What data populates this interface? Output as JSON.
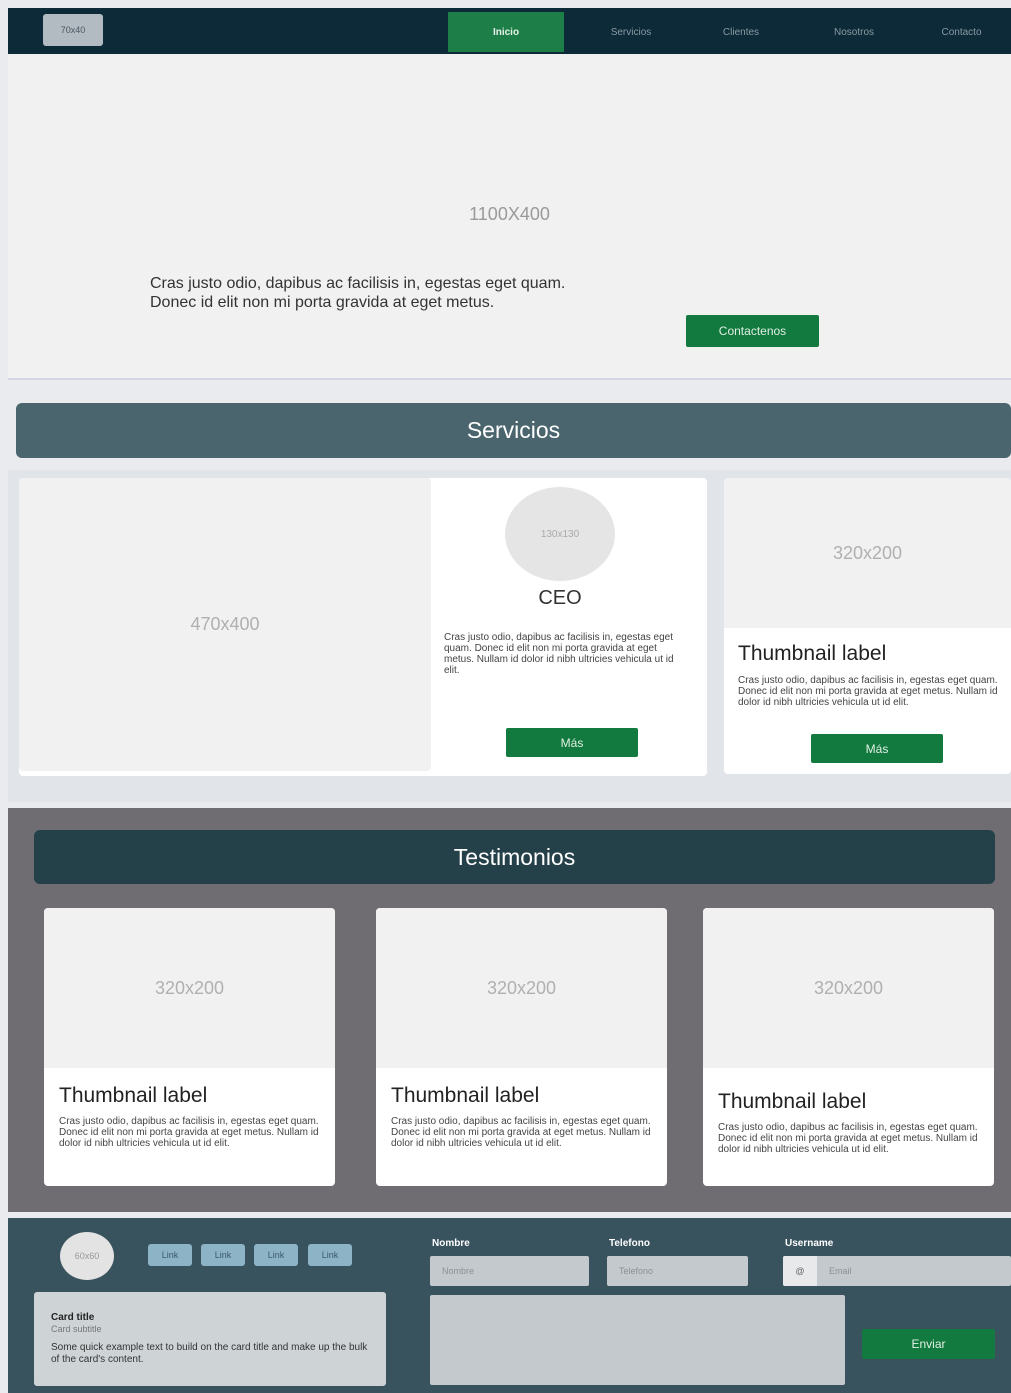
{
  "navbar": {
    "logo": "70x40",
    "items": [
      {
        "label": "Inicio",
        "active": true
      },
      {
        "label": "Servicios",
        "active": false
      },
      {
        "label": "Clientes",
        "active": false
      },
      {
        "label": "Nosotros",
        "active": false
      },
      {
        "label": "Contacto",
        "active": false
      }
    ]
  },
  "hero": {
    "placeholder": "1100X400",
    "text": "Cras justo odio, dapibus ac facilisis in, egestas eget quam. Donec id elit non mi porta gravida at eget metus.",
    "button": "Contactenos"
  },
  "servicios": {
    "title": "Servicios",
    "main_placeholder": "470x400",
    "ceo": {
      "avatar": "130x130",
      "title": "CEO",
      "text": "Cras justo odio, dapibus ac facilisis in, egestas eget quam. Donec id elit non mi porta gravida at eget metus. Nullam id dolor id nibh ultricies vehicula ut id elit.",
      "button": "Más"
    },
    "thumb": {
      "placeholder": "320x200",
      "label": "Thumbnail label",
      "text": "Cras justo odio, dapibus ac facilisis in, egestas eget quam. Donec id elit non mi porta gravida at eget metus. Nullam id dolor id nibh ultricies vehicula ut id elit.",
      "button": "Más"
    }
  },
  "testimonios": {
    "title": "Testimonios",
    "cards": [
      {
        "placeholder": "320x200",
        "label": "Thumbnail label",
        "text": "Cras justo odio, dapibus ac facilisis in, egestas eget quam. Donec id elit non mi porta gravida at eget metus. Nullam id dolor id nibh ultricies vehicula ut id elit."
      },
      {
        "placeholder": "320x200",
        "label": "Thumbnail label",
        "text": "Cras justo odio, dapibus ac facilisis in, egestas eget quam. Donec id elit non mi porta gravida at eget metus. Nullam id dolor id nibh ultricies vehicula ut id elit."
      },
      {
        "placeholder": "320x200",
        "label": "Thumbnail label",
        "text": "Cras justo odio, dapibus ac facilisis in, egestas eget quam. Donec id elit non mi porta gravida at eget metus. Nullam id dolor id nibh ultricies vehicula ut id elit."
      }
    ]
  },
  "footer": {
    "avatar": "60x60",
    "links": [
      "Link",
      "Link",
      "Link",
      "Link"
    ],
    "card": {
      "title": "Card title",
      "subtitle": "Card subtitle",
      "text": "Some quick example text to build on the card title and make up the bulk of the card's content."
    },
    "form": {
      "nombre_label": "Nombre",
      "nombre_placeholder": "Nombre",
      "telefono_label": "Telefono",
      "telefono_placeholder": "Telefono",
      "username_label": "Username",
      "email_addon": "@",
      "email_placeholder": "Email",
      "submit": "Enviar"
    }
  },
  "colors": {
    "navbar": "#0c2a38",
    "accent_green": "#127a3e",
    "servicios_header": "#4a656d",
    "testimonios_bg": "#6f6d72",
    "testimonios_header": "#24414a",
    "footer": "#38525e"
  }
}
